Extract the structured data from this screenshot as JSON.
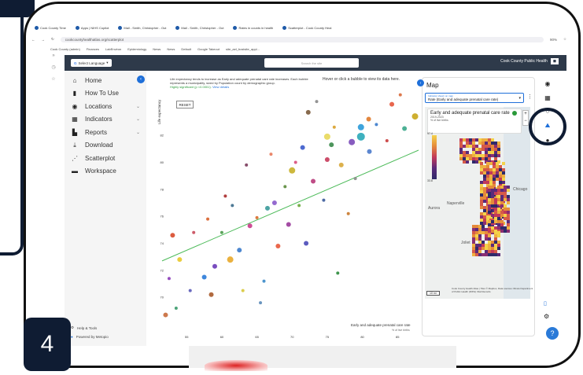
{
  "slide": {
    "number": "4"
  },
  "browser": {
    "tabs": [
      {
        "label": "Cook County Time"
      },
      {
        "label": "Apps | NIHS Copilot"
      },
      {
        "label": "Mail - Smith, Christopher - Out"
      },
      {
        "label": "Mail - Smith, Christopher - Out"
      },
      {
        "label": "Rates in counts in health"
      },
      {
        "label": "Scatterplot - Cook County Heal",
        "active": true
      }
    ],
    "url": "cookcountyhealthatlas.org/scatterplot",
    "zoom": "90%",
    "bookmarks": [
      "Cook County (admin)",
      "Finances",
      "LabEnviron",
      "Epidemiology",
      "News",
      "News",
      "Default",
      "Google Takeout",
      "site_ael_bostsite_appl..."
    ]
  },
  "header": {
    "language_button": "Select Language",
    "search_placeholder": "Search the site",
    "logo_text": "Cook County Public Health"
  },
  "sidebar": {
    "items": [
      {
        "label": "Home",
        "icon": "home-icon",
        "glyph": "⌂"
      },
      {
        "label": "How To Use",
        "icon": "book-icon",
        "glyph": "▮"
      },
      {
        "label": "Locations",
        "icon": "globe-icon",
        "glyph": "◉",
        "chevron": true
      },
      {
        "label": "Indicators",
        "icon": "chart-icon",
        "glyph": "▦",
        "chevron": true
      },
      {
        "label": "Reports",
        "icon": "bookmark-icon",
        "glyph": "▙",
        "chevron": true
      },
      {
        "label": "Download",
        "icon": "download-icon",
        "glyph": "⤓"
      },
      {
        "label": "Scatterplot",
        "icon": "scatter-icon",
        "glyph": "⋰"
      },
      {
        "label": "Workspace",
        "icon": "folder-icon",
        "glyph": "▬"
      }
    ],
    "footer": {
      "help": "Help & Tools",
      "powered": "Powered by Metopio"
    }
  },
  "plot": {
    "info_text": "Life expectancy tends to increase as Early and adequate prenatal care rate increases. Each bubble represents a municipality, sized by Population count by demographic group.",
    "significance": "Highly significant (p <0.0001).",
    "see_details": "View details",
    "reset_label": "RESET",
    "hover_hint": "Hover or click a bubble to view its data here."
  },
  "map": {
    "title": "Map",
    "select_label": "Indicator shown on map",
    "select_value": "Rate (Early and adequate prenatal care rate)",
    "legend_title": "Early and adequate prenatal care rate",
    "legend_period": "2019-2023",
    "legend_unit": "% of live births",
    "legend_top": "97.4",
    "legend_bottom": "33.8",
    "places": [
      "Chicago",
      "Naperville",
      "Aurora",
      "Joliet"
    ],
    "scale": "10 mi",
    "attribution": "Cook County Health Atlas | Tiles © Mapbox, Data sources: Illinois Department of Public Health (IDPH) Vital Records"
  },
  "rail": {
    "icons": [
      "globe-icon",
      "report-icon",
      "scatter-icon",
      "map-icon",
      "pin-icon"
    ]
  },
  "chart_data": {
    "type": "scatter",
    "title": "",
    "xlabel": "Early and adequate prenatal care rate",
    "xunit": "% of live births",
    "ylabel": "Life expectancy",
    "x_ticks": [
      55,
      60,
      65,
      70,
      75,
      80,
      85
    ],
    "y_ticks": [
      70,
      72,
      74,
      76,
      78,
      80,
      82
    ],
    "xlim": [
      51.5,
      88
    ],
    "ylim": [
      68.5,
      85.5
    ],
    "points": [
      {
        "x": 87.5,
        "y": 83.4,
        "r": 4,
        "c": "#c9a61a"
      },
      {
        "x": 85.4,
        "y": 85.0,
        "r": 2,
        "c": "#d96a3a"
      },
      {
        "x": 84.2,
        "y": 84.3,
        "r": 3,
        "c": "#e6553a"
      },
      {
        "x": 82.0,
        "y": 82.8,
        "r": 2,
        "c": "#3a7acb"
      },
      {
        "x": 80.9,
        "y": 83.2,
        "r": 3,
        "c": "#e07a2a"
      },
      {
        "x": 79.8,
        "y": 82.6,
        "r": 4,
        "c": "#2a9ad8"
      },
      {
        "x": 79.8,
        "y": 81.9,
        "r": 5,
        "c": "#2aa9b8"
      },
      {
        "x": 78.5,
        "y": 81.5,
        "r": 4,
        "c": "#7a4ab8"
      },
      {
        "x": 76.0,
        "y": 82.6,
        "r": 2,
        "c": "#d8a02a"
      },
      {
        "x": 75.6,
        "y": 81.3,
        "r": 3,
        "c": "#3a8a4a"
      },
      {
        "x": 75.0,
        "y": 81.9,
        "r": 4,
        "c": "#e8d85a"
      },
      {
        "x": 75.0,
        "y": 80.2,
        "r": 3,
        "c": "#c73a5a"
      },
      {
        "x": 73.5,
        "y": 84.5,
        "r": 2,
        "c": "#888888"
      },
      {
        "x": 72.3,
        "y": 83.7,
        "r": 3,
        "c": "#7a5a3a"
      },
      {
        "x": 71.5,
        "y": 81.1,
        "r": 3,
        "c": "#3a5acb"
      },
      {
        "x": 70.5,
        "y": 80.0,
        "r": 2,
        "c": "#d84a7a"
      },
      {
        "x": 70.0,
        "y": 79.4,
        "r": 4,
        "c": "#c8b028"
      },
      {
        "x": 69.0,
        "y": 78.2,
        "r": 2,
        "c": "#5a8a3a"
      },
      {
        "x": 67.5,
        "y": 77.0,
        "r": 3,
        "c": "#8a5acb"
      },
      {
        "x": 66.5,
        "y": 76.6,
        "r": 3,
        "c": "#3a9a9a"
      },
      {
        "x": 65.0,
        "y": 75.9,
        "r": 2,
        "c": "#d86a2a"
      },
      {
        "x": 64.0,
        "y": 75.3,
        "r": 3,
        "c": "#c83a8a"
      },
      {
        "x": 63.5,
        "y": 79.8,
        "r": 2,
        "c": "#7a3a5a"
      },
      {
        "x": 62.5,
        "y": 73.5,
        "r": 3,
        "c": "#3a7acb"
      },
      {
        "x": 61.2,
        "y": 72.8,
        "r": 4,
        "c": "#e8a82a"
      },
      {
        "x": 60.5,
        "y": 77.5,
        "r": 2,
        "c": "#a82a2a"
      },
      {
        "x": 60.0,
        "y": 74.8,
        "r": 2,
        "c": "#4a9a4a"
      },
      {
        "x": 59.0,
        "y": 72.3,
        "r": 3,
        "c": "#6a3ab8"
      },
      {
        "x": 58.0,
        "y": 75.8,
        "r": 2,
        "c": "#d8602a"
      },
      {
        "x": 57.5,
        "y": 71.5,
        "r": 3,
        "c": "#2a7ad8"
      },
      {
        "x": 56.0,
        "y": 74.8,
        "r": 2,
        "c": "#c84a5a"
      },
      {
        "x": 55.5,
        "y": 70.5,
        "r": 2,
        "c": "#5a5ab8"
      },
      {
        "x": 54.0,
        "y": 72.8,
        "r": 3,
        "c": "#e8c82a"
      },
      {
        "x": 53.5,
        "y": 69.2,
        "r": 2,
        "c": "#3a9a6a"
      },
      {
        "x": 53.0,
        "y": 74.6,
        "r": 3,
        "c": "#d84a2a"
      },
      {
        "x": 52.5,
        "y": 71.4,
        "r": 2,
        "c": "#8a3ab8"
      },
      {
        "x": 52.0,
        "y": 68.7,
        "r": 3,
        "c": "#c86a3a"
      },
      {
        "x": 66.0,
        "y": 71.2,
        "r": 2,
        "c": "#3a8ac8"
      },
      {
        "x": 68.0,
        "y": 73.8,
        "r": 3,
        "c": "#e8583a"
      },
      {
        "x": 71.0,
        "y": 76.8,
        "r": 2,
        "c": "#6aa83a"
      },
      {
        "x": 73.0,
        "y": 78.6,
        "r": 3,
        "c": "#b83a7a"
      },
      {
        "x": 74.5,
        "y": 77.2,
        "r": 2,
        "c": "#3a5a9a"
      },
      {
        "x": 77.0,
        "y": 79.8,
        "r": 3,
        "c": "#d8a83a"
      },
      {
        "x": 79.0,
        "y": 78.8,
        "r": 2,
        "c": "#8a8a8a"
      },
      {
        "x": 81.0,
        "y": 80.8,
        "r": 3,
        "c": "#4a7acb"
      },
      {
        "x": 83.5,
        "y": 81.6,
        "r": 2,
        "c": "#c83a3a"
      },
      {
        "x": 86.0,
        "y": 82.5,
        "r": 3,
        "c": "#3aa88a"
      },
      {
        "x": 63.0,
        "y": 70.5,
        "r": 2,
        "c": "#d8c83a"
      },
      {
        "x": 58.5,
        "y": 70.2,
        "r": 3,
        "c": "#a85a2a"
      },
      {
        "x": 65.5,
        "y": 69.6,
        "r": 2,
        "c": "#5a8ab8"
      },
      {
        "x": 76.5,
        "y": 71.8,
        "r": 2,
        "c": "#2a8a3a"
      },
      {
        "x": 69.5,
        "y": 75.4,
        "r": 3,
        "c": "#9a3a9a"
      },
      {
        "x": 61.5,
        "y": 76.8,
        "r": 2,
        "c": "#3a6a8a"
      },
      {
        "x": 67.0,
        "y": 80.6,
        "r": 2,
        "c": "#e87a5a"
      },
      {
        "x": 72.0,
        "y": 74.0,
        "r": 3,
        "c": "#4a4ab8"
      },
      {
        "x": 78.0,
        "y": 76.2,
        "r": 2,
        "c": "#c8782a"
      }
    ],
    "trendline": {
      "x": [
        51.5,
        88
      ],
      "y": [
        72.7,
        80.9
      ],
      "color": "#4dbb5a"
    },
    "grid": false
  }
}
